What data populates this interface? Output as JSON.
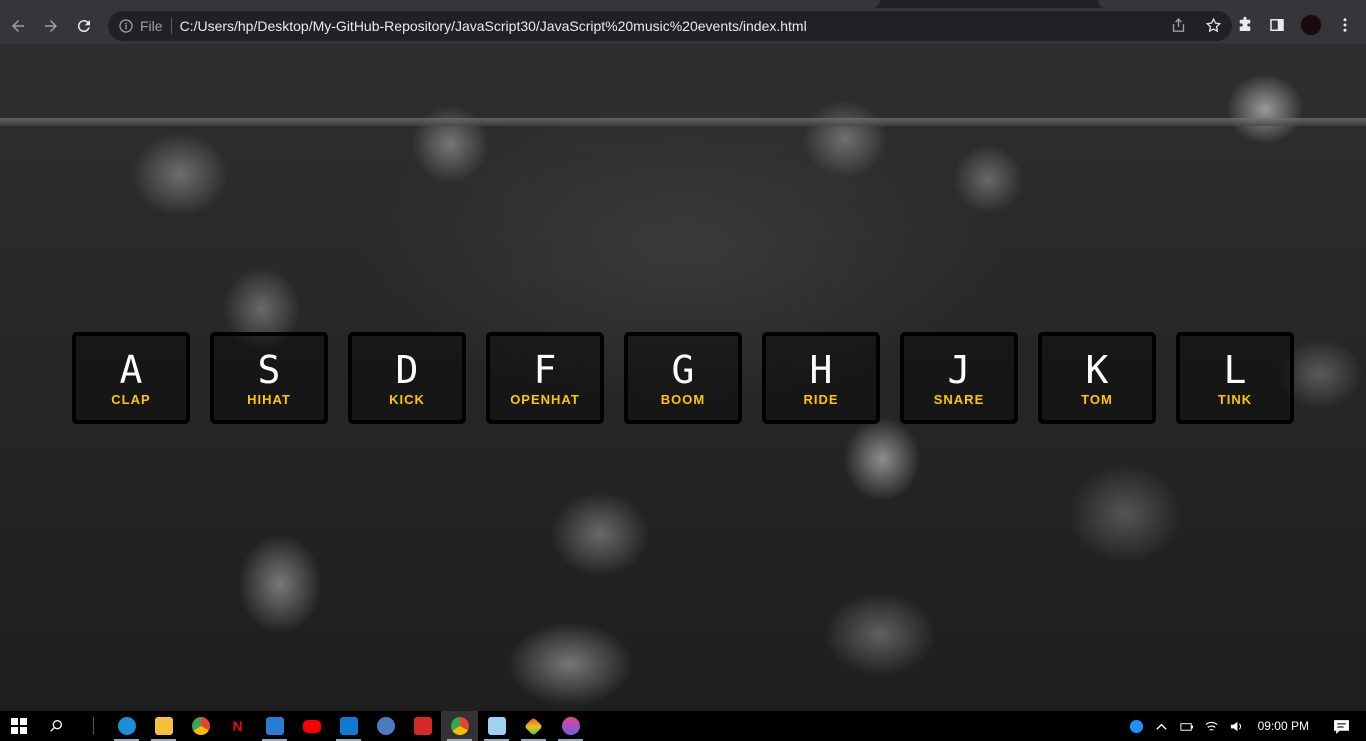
{
  "browser": {
    "omnibox_file_label": "File",
    "url": "C:/Users/hp/Desktop/My-GitHub-Repository/JavaScript30/JavaScript%20music%20events/index.html"
  },
  "keys": [
    {
      "key": "A",
      "sound": "clap"
    },
    {
      "key": "S",
      "sound": "hihat"
    },
    {
      "key": "D",
      "sound": "kick"
    },
    {
      "key": "F",
      "sound": "openhat"
    },
    {
      "key": "G",
      "sound": "boom"
    },
    {
      "key": "H",
      "sound": "ride"
    },
    {
      "key": "J",
      "sound": "snare"
    },
    {
      "key": "K",
      "sound": "tom"
    },
    {
      "key": "L",
      "sound": "tink"
    }
  ],
  "taskbar": {
    "icons": [
      "windows-start-icon",
      "search-icon",
      "edge-icon",
      "file-explorer-icon",
      "chrome-icon",
      "netflix-icon",
      "calculator-icon",
      "youtube-icon",
      "vscode-icon",
      "app-icon",
      "acrobat-icon",
      "chrome-icon",
      "notepad-icon",
      "git-icon",
      "paint-icon"
    ],
    "clock": "09:00 PM"
  },
  "colors": {
    "accent": "#ffc600",
    "key_text": "#ffffff",
    "chrome_bg": "#35363a"
  }
}
